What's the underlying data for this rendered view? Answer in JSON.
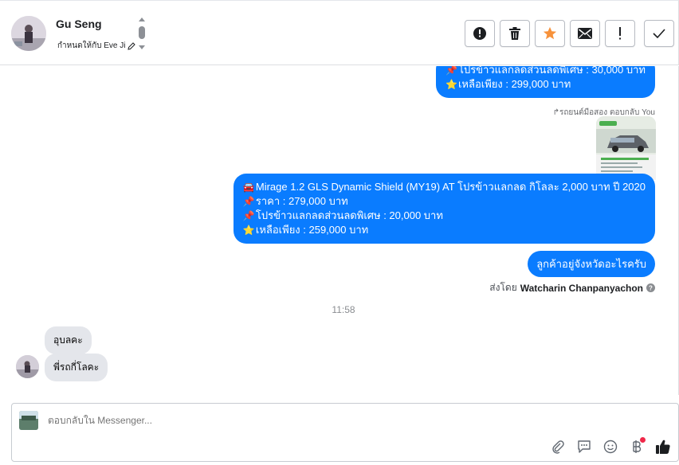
{
  "header": {
    "contact_name": "Gu Seng",
    "assigned_to": "กำหนดให้กับ Eve Ji",
    "actions": [
      {
        "name": "spam-button",
        "icon": "alert-circle-icon"
      },
      {
        "name": "delete-button",
        "icon": "trash-icon"
      },
      {
        "name": "star-button",
        "icon": "star-icon"
      },
      {
        "name": "mark-unread-button",
        "icon": "envelope-icon"
      },
      {
        "name": "follow-up-button",
        "icon": "exclamation-icon"
      },
      {
        "name": "mark-done-button",
        "icon": "check-icon"
      }
    ]
  },
  "messages": {
    "top_bubble": {
      "line1": "โปรข้าวแลกลดส่วนลดพิเศษ : 30,000 บาท",
      "line2": "เหลือเพียง : 299,000 บาท"
    },
    "reply_note": "↱รถยนต์มือสอง ตอบกลับ You",
    "car_bubble": {
      "line1": "Mirage 1.2 GLS Dynamic Shield (MY19) AT โปรข้าวแลกลด กิโลละ 2,000 บาท ปี 2020",
      "line2": "ราคา : 279,000 บาท",
      "line3": "โปรข้าวแลกลดส่วนลดพิเศษ : 20,000 บาท",
      "line4": "เหลือเพียง : 259,000 บาท"
    },
    "question_bubble": "ลูกค้าอยู่จังหวัดอะไรครับ",
    "sent_by_label": "ส่งโดย",
    "sent_by_name": "Watcharin Chanpanyachon",
    "timestamp": "11:58",
    "incoming": [
      {
        "text": "อุบลคะ"
      },
      {
        "text": "พี่รถกี่โลคะ"
      }
    ]
  },
  "composer": {
    "placeholder": "ตอบกลับใน Messenger..."
  },
  "colors": {
    "outgoing_bubble": "#0a7cff",
    "incoming_bubble": "#e4e6eb",
    "star": "#f7923b",
    "like": "#1c1e21",
    "badge": "#f02849"
  }
}
